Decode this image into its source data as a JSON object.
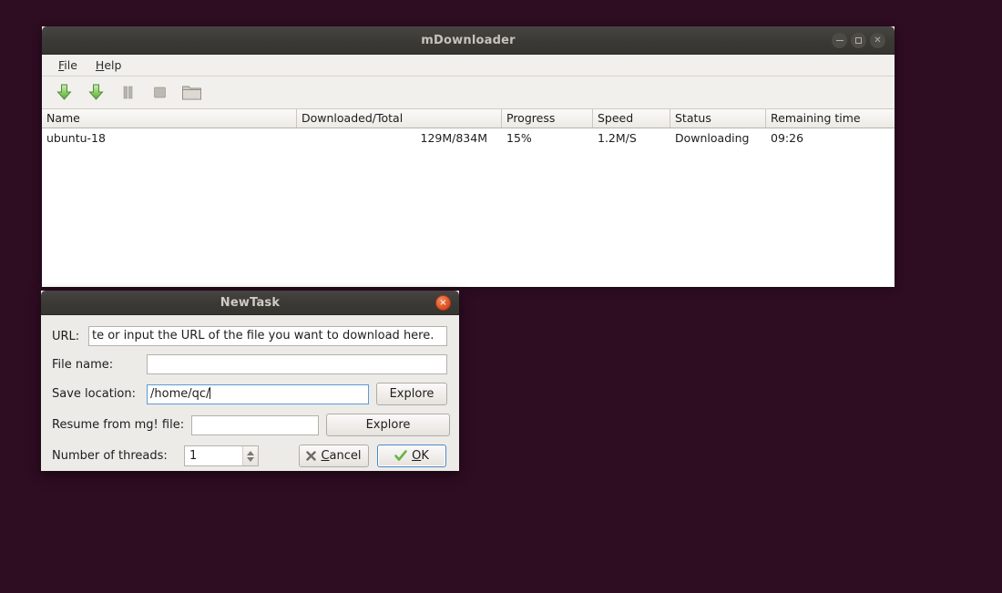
{
  "desktop": {
    "background": "#2e0c22"
  },
  "main_window": {
    "title": "mDownloader",
    "window_buttons": [
      {
        "name": "minimize",
        "glyph": "minimize-icon"
      },
      {
        "name": "maximize",
        "glyph": "maximize-icon"
      },
      {
        "name": "close",
        "glyph": "close-icon"
      }
    ],
    "menu": [
      {
        "label": "File",
        "accel": "F"
      },
      {
        "label": "Help",
        "accel": "H"
      }
    ],
    "toolbar": [
      {
        "name": "new-download-icon",
        "tip": "New download"
      },
      {
        "name": "start-download-icon",
        "tip": "Start download"
      },
      {
        "name": "pause-icon",
        "tip": "Pause"
      },
      {
        "name": "stop-icon",
        "tip": "Stop"
      },
      {
        "name": "open-folder-icon",
        "tip": "Open folder"
      }
    ],
    "table": {
      "columns": [
        "Name",
        "Downloaded/Total",
        "Progress",
        "Speed",
        "Status",
        "Remaining time"
      ],
      "rows": [
        {
          "name": "ubuntu-18",
          "downloaded_total": "129M/834M",
          "progress": "15%",
          "speed": "1.2M/S",
          "status": "Downloading",
          "remaining_time": "09:26"
        }
      ]
    }
  },
  "dialog": {
    "title": "NewTask",
    "close_label": "×",
    "fields": {
      "url": {
        "label": "URL:",
        "value": "te or input the URL of the file you want to download here.",
        "placeholder": "Paste or input the URL of the file you want to download here."
      },
      "file_name": {
        "label": "File name:",
        "value": "",
        "placeholder": ""
      },
      "save_location": {
        "label": "Save location:",
        "value": "/home/qc/",
        "placeholder": ""
      },
      "resume_file": {
        "label": "Resume from mg! file:",
        "value": "",
        "placeholder": ""
      },
      "threads": {
        "label": "Number of threads:",
        "value": "1"
      }
    },
    "buttons": {
      "explore_save": "Explore",
      "explore_resume": "Explore",
      "cancel": "Cancel",
      "cancel_accel": "C",
      "ok": "OK",
      "ok_accel": "O"
    }
  }
}
